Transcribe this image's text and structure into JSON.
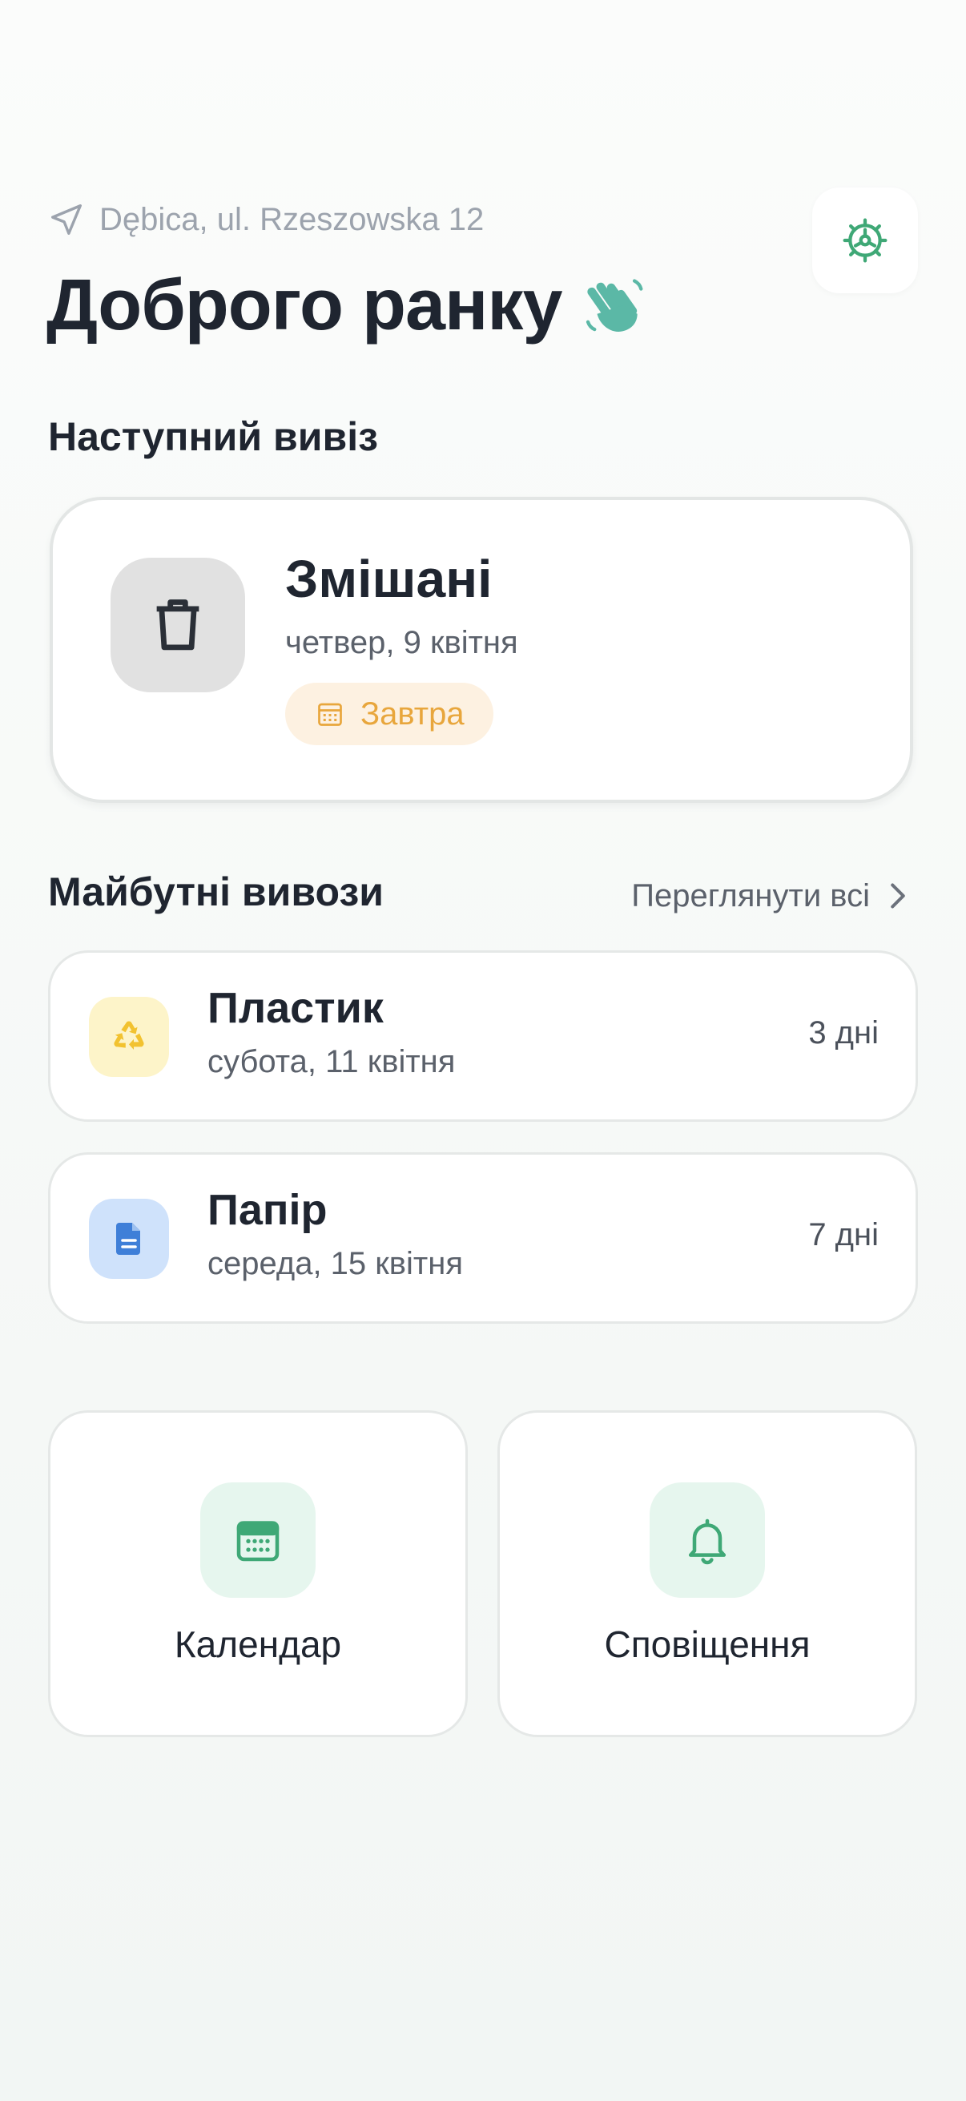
{
  "header": {
    "location": "Dębica, ul. Rzeszowska 12",
    "greeting": "Доброго ранку"
  },
  "next_pickup": {
    "section_title": "Наступний вивіз",
    "type": "Змішані",
    "date": "четвер, 9 квітня",
    "badge": "Завтра"
  },
  "upcoming": {
    "section_title": "Майбутні вивози",
    "see_all": "Переглянути всі",
    "items": [
      {
        "title": "Пластик",
        "date": "субота, 11 квітня",
        "days": "3 дні",
        "icon": "recycle-icon",
        "color": "#f2c230"
      },
      {
        "title": "Папір",
        "date": "середа, 15 квітня",
        "days": "7 дні",
        "icon": "document-icon",
        "color": "#3f7fd8"
      }
    ]
  },
  "tiles": [
    {
      "label": "Календар",
      "icon": "calendar-icon"
    },
    {
      "label": "Сповіщення",
      "icon": "bell-icon"
    }
  ],
  "colors": {
    "accent": "#3fa876",
    "wave": "#5bb8a6",
    "badge_text": "#e8a63c",
    "text_primary": "#1f2530",
    "text_secondary": "#5b616b"
  }
}
